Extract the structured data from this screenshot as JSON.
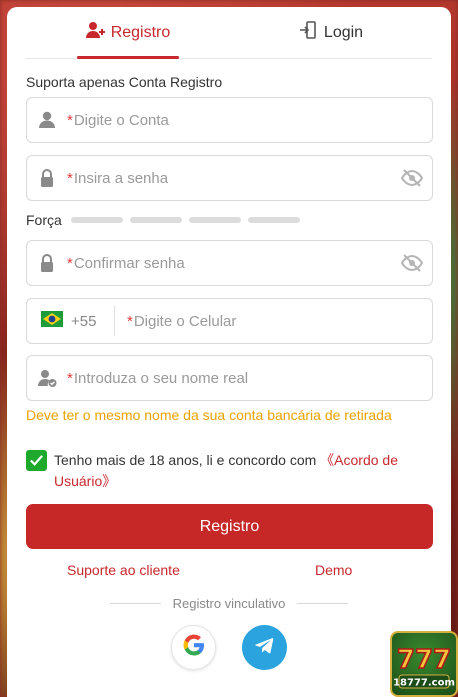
{
  "tabs": [
    {
      "label": "Registro",
      "icon": "user-plus-icon",
      "active": true
    },
    {
      "label": "Login",
      "icon": "door-enter-icon",
      "active": false
    }
  ],
  "hint": "Suporta apenas Conta Registro",
  "fields": {
    "account": {
      "required_mark": "*",
      "placeholder": "Digite o Conta",
      "icon": "user-icon"
    },
    "password": {
      "required_mark": "*",
      "placeholder": "Insira a senha",
      "icon": "lock-icon"
    },
    "confirm": {
      "required_mark": "*",
      "placeholder": "Confirmar senha",
      "icon": "lock-icon"
    },
    "phone": {
      "country_code": "+55",
      "required_mark": "*",
      "placeholder": "Digite o Celular",
      "flag": "brazil-flag-icon"
    },
    "realname": {
      "required_mark": "*",
      "placeholder": "Introduza o seu nome real",
      "icon": "user-check-icon"
    }
  },
  "strength": {
    "label": "Força",
    "level": 0,
    "segments": 4
  },
  "bank_note": "Deve ter o mesmo nome da sua conta bancária de retirada",
  "agree": {
    "checked": true,
    "text": "Tenho mais de 18 anos, li e concordo com ",
    "link": "《Acordo de Usuário》"
  },
  "submit_label": "Registro",
  "links": {
    "support": "Suporte ao cliente",
    "demo": "Demo"
  },
  "divider_label": "Registro vinculativo",
  "social": [
    "google-icon",
    "telegram-icon"
  ],
  "colors": {
    "accent": "#c8282d",
    "button": "#c62828",
    "warning": "#e8a200",
    "check": "#1ea82c"
  }
}
